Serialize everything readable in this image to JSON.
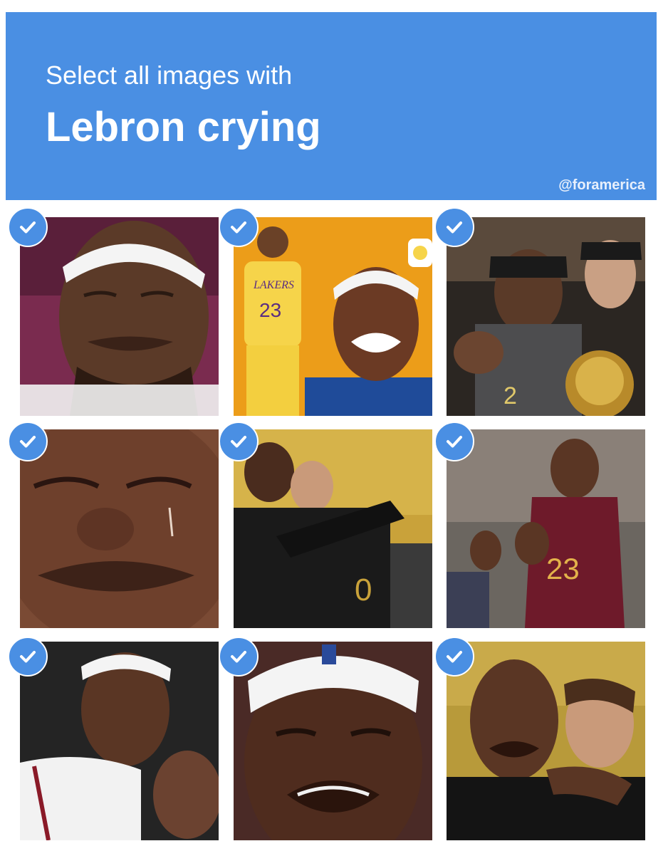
{
  "header": {
    "instruction": "Select all images with",
    "target": "Lebron crying",
    "credit": "@foramerica"
  },
  "colors": {
    "accent": "#4a8fe3",
    "tile_background": "#ffffff"
  },
  "icons": {
    "selected_marker": "check-icon"
  },
  "grid": {
    "rows": 3,
    "columns": 3,
    "tiles": [
      {
        "selected": true,
        "jersey_text": ""
      },
      {
        "selected": true,
        "jersey_text": "23"
      },
      {
        "selected": true,
        "jersey_text": "2"
      },
      {
        "selected": true,
        "jersey_text": ""
      },
      {
        "selected": true,
        "jersey_text": "0"
      },
      {
        "selected": true,
        "jersey_text": "23"
      },
      {
        "selected": true,
        "jersey_text": ""
      },
      {
        "selected": true,
        "jersey_text": ""
      },
      {
        "selected": true,
        "jersey_text": ""
      }
    ]
  }
}
